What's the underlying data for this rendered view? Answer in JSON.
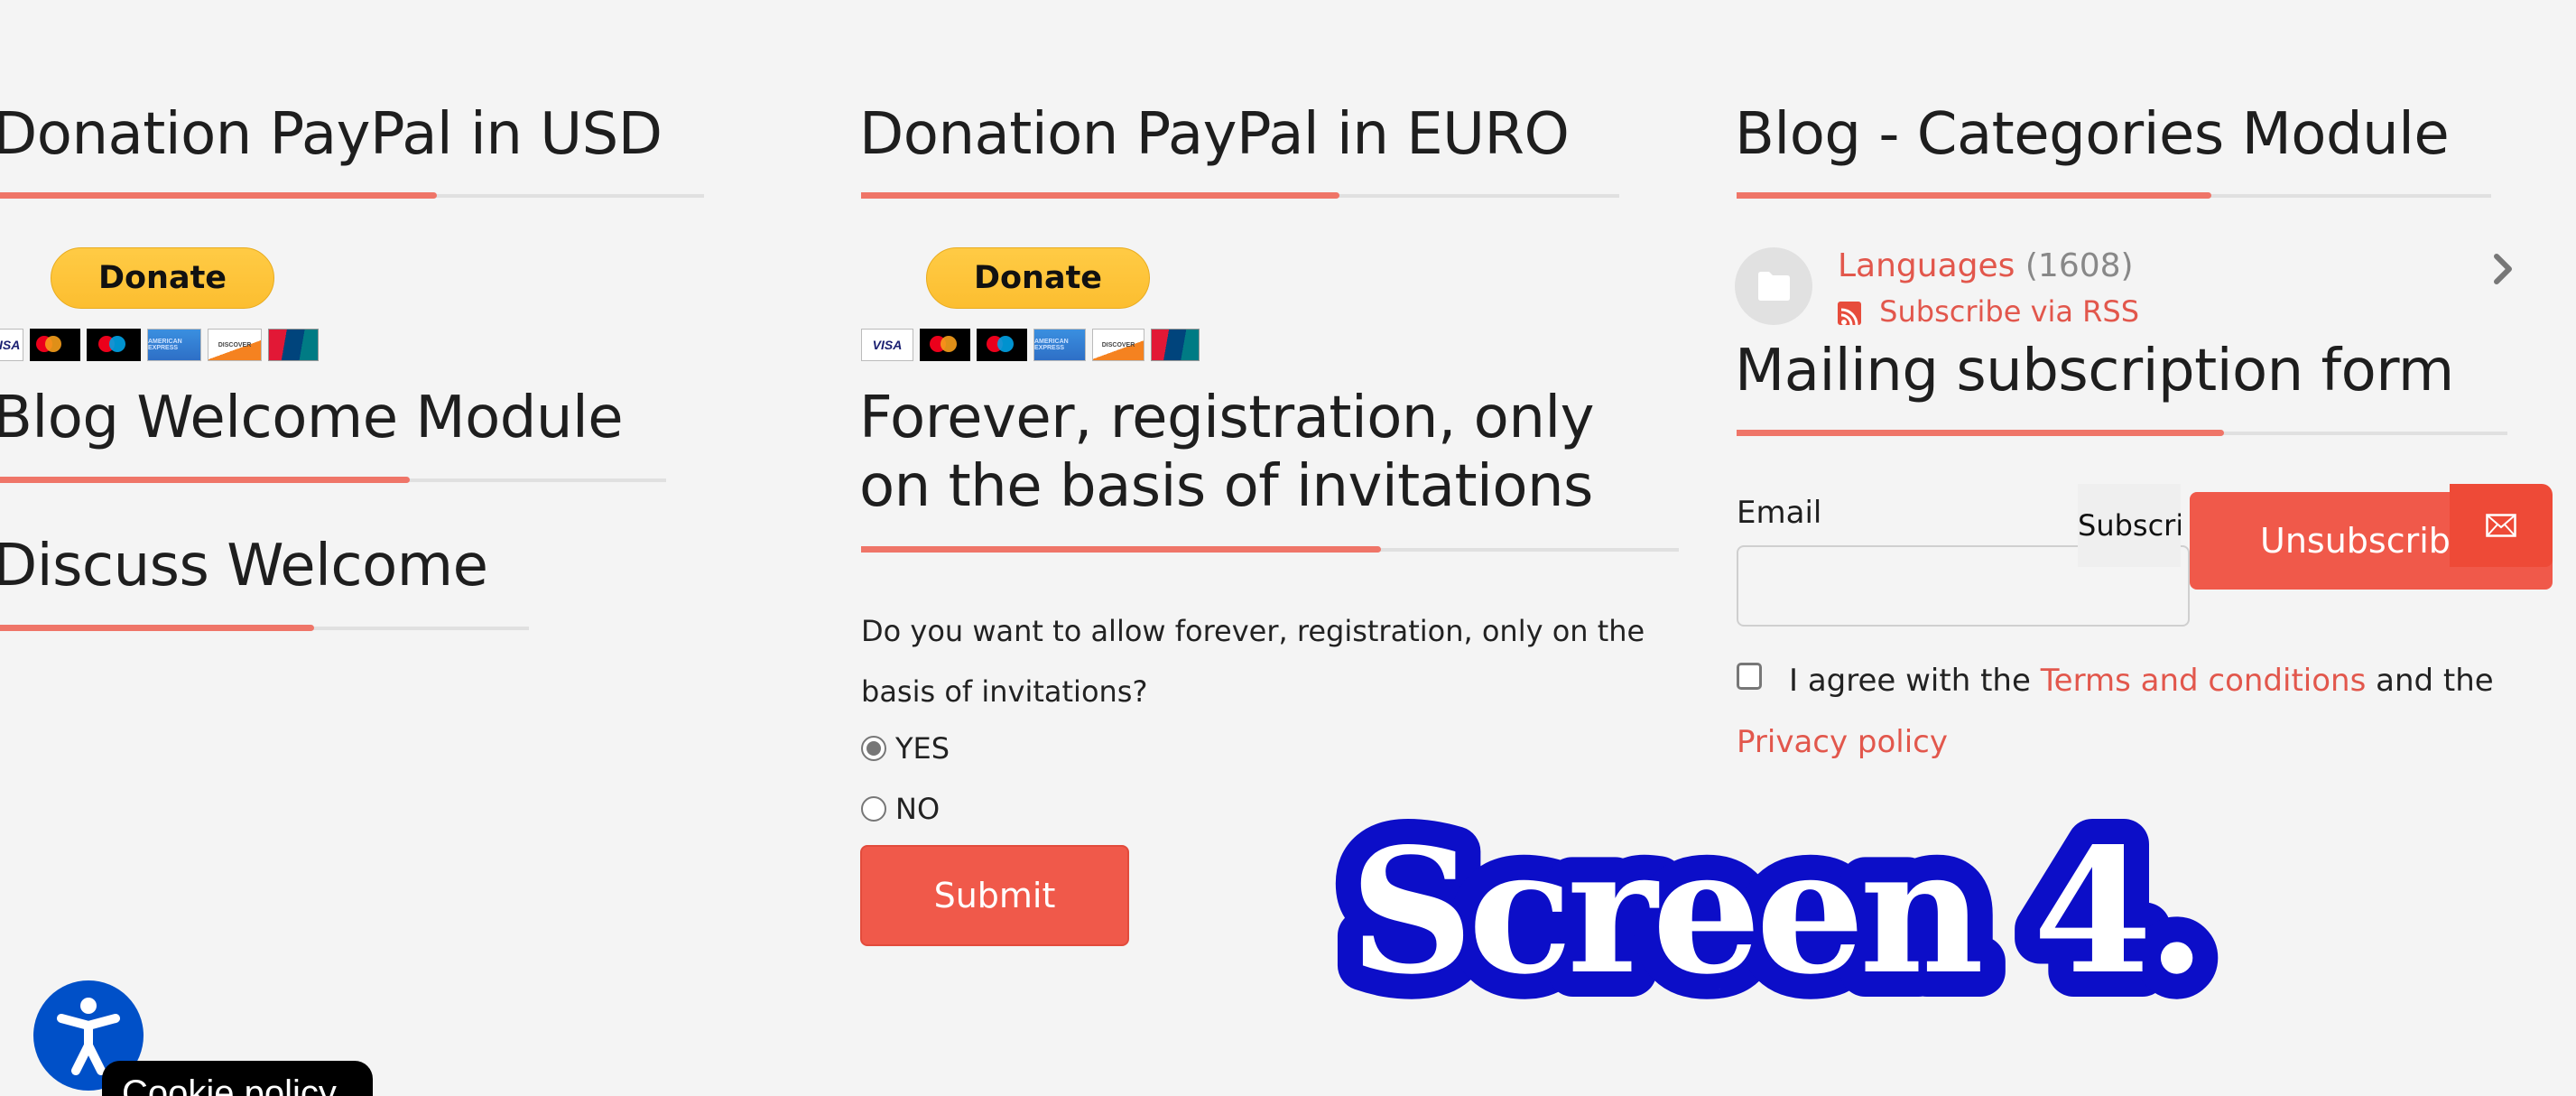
{
  "col1": {
    "usd_heading": "Donation PayPal in USD",
    "donate_label": "Donate",
    "cards": [
      "VISA",
      "Mastercard",
      "Maestro",
      "American Express",
      "Discover",
      "UnionPay"
    ],
    "blog_welcome_heading": "Blog Welcome Module",
    "discuss_heading": "Discuss Welcome"
  },
  "col2": {
    "euro_heading": "Donation PayPal in EURO",
    "donate_label": "Donate",
    "forever_heading_line1": "Forever, registration, only",
    "forever_heading_line2": "on the basis of invitations",
    "question_line1": "Do you want to allow forever, registration, only on the",
    "question_line2": "basis of invitations?",
    "options": [
      {
        "label": "YES",
        "checked": true
      },
      {
        "label": "NO",
        "checked": false
      }
    ],
    "submit_label": "Submit"
  },
  "col3": {
    "categories_heading": "Blog - Categories Module",
    "category": {
      "name": "Languages",
      "count": "(1608)",
      "rss_label": "Subscribe via RSS"
    },
    "mailing_heading": "Mailing subscription form",
    "email_label": "Email",
    "email_value": "",
    "subscribe_label": "Subscri",
    "unsubscribe_label": "Unsubscrib",
    "agree_prefix": "I agree with the",
    "terms_link": "Terms and conditions",
    "agree_middle": "and the",
    "privacy_link": "Privacy policy",
    "agree_checked": false
  },
  "overlay": {
    "cookie_label": "Cookie policy",
    "screen_label": "Screen 4."
  },
  "colors": {
    "accent": "#ef7568",
    "button_red": "#f0594a",
    "link_red": "#e2574c",
    "paypal_yellow": "#ffc439",
    "accessibility_blue": "#0050c8",
    "screen_label_blue": "#0c0ec8"
  }
}
